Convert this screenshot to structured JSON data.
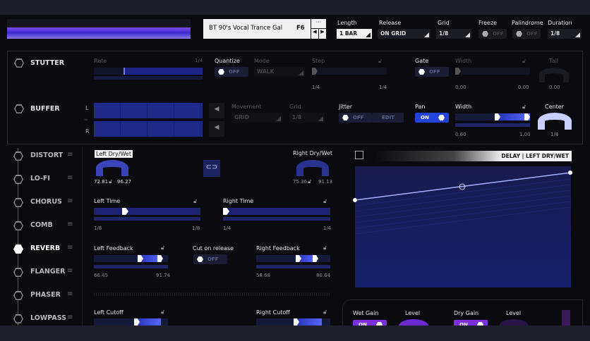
{
  "header": {
    "preset_name": "BT 90's Vocal Trance Gal",
    "preset_key": "F6",
    "more_label": "···",
    "length": {
      "label": "Length",
      "value": "1 BAR"
    },
    "release": {
      "label": "Release",
      "value": "ON GRID"
    },
    "grid": {
      "label": "Grid",
      "value": "1/8"
    },
    "freeze": {
      "label": "Freeze",
      "value": "OFF"
    },
    "palindrome": {
      "label": "Palindrome",
      "value": "OFF"
    },
    "duration": {
      "label": "Duration",
      "value": "1/8"
    }
  },
  "stutter": {
    "name": "STUTTER",
    "rate_label": "Rate",
    "rate_max": "1/4",
    "quantize_label": "Quantize",
    "quantize_value": "OFF",
    "mode_label": "Mode",
    "mode_value": "WALK",
    "step_label": "Step",
    "step_min": "1/4",
    "step_max": "1/4",
    "gate_label": "Gate",
    "gate_value": "OFF",
    "width_label": "Width",
    "width_min": "0.00",
    "width_max": "0.00",
    "tail_label": "Tail",
    "tail_value": "0.00"
  },
  "buffer": {
    "name": "BUFFER",
    "left_label": "L",
    "right_label": "R",
    "link_label": "∞",
    "movement_label": "Movement",
    "movement_value": "GRID",
    "grid_label": "Grid",
    "grid_value": "1/8",
    "jitter_label": "Jitter",
    "jitter_value": "OFF",
    "jitter_edit": "EDIT",
    "pan_label": "Pan",
    "pan_value": "ON",
    "width_label": "Width",
    "width_min": "0.60",
    "width_max": "1.00",
    "center_label": "Center",
    "center_value": "1/4"
  },
  "sidebar": {
    "items": [
      {
        "label": "DISTORT"
      },
      {
        "label": "LO-FI"
      },
      {
        "label": "CHORUS"
      },
      {
        "label": "COMB"
      },
      {
        "label": "REVERB",
        "active": true
      },
      {
        "label": "FLANGER"
      },
      {
        "label": "PHASER"
      },
      {
        "label": "LOWPASS"
      }
    ]
  },
  "delay": {
    "left_drywet": {
      "label": "Left Dry/Wet",
      "min": "72.81",
      "max": "96.27"
    },
    "right_drywet": {
      "label": "Right Dry/Wet",
      "min": "75.36",
      "max": "91.13"
    },
    "left_time": {
      "label": "Left Time",
      "min": "1/8",
      "max": "1/8"
    },
    "right_time": {
      "label": "Right Time",
      "min": "1/4",
      "max": "1/4"
    },
    "left_feedback": {
      "label": "Left Feedback",
      "min": "66.45",
      "max": "91.74"
    },
    "cut_on_release": {
      "label": "Cut on release",
      "value": "OFF"
    },
    "right_feedback": {
      "label": "Right Feedback",
      "min": "58.68",
      "max": "80.64"
    },
    "left_cutoff": {
      "label": "Left Cutoff"
    },
    "right_cutoff": {
      "label": "Right Cutoff"
    }
  },
  "graph": {
    "title": "DELAY | LEFT DRY/WET"
  },
  "output": {
    "wet_gain_label": "Wet Gain",
    "wet_gain_value": "ON",
    "wet_level_label": "Level",
    "dry_gain_label": "Dry Gain",
    "dry_gain_value": "ON",
    "dry_level_label": "Level"
  },
  "colors": {
    "accent": "#3a4cff",
    "purple": "#7a2fe0",
    "background": "#0b0b0f"
  }
}
